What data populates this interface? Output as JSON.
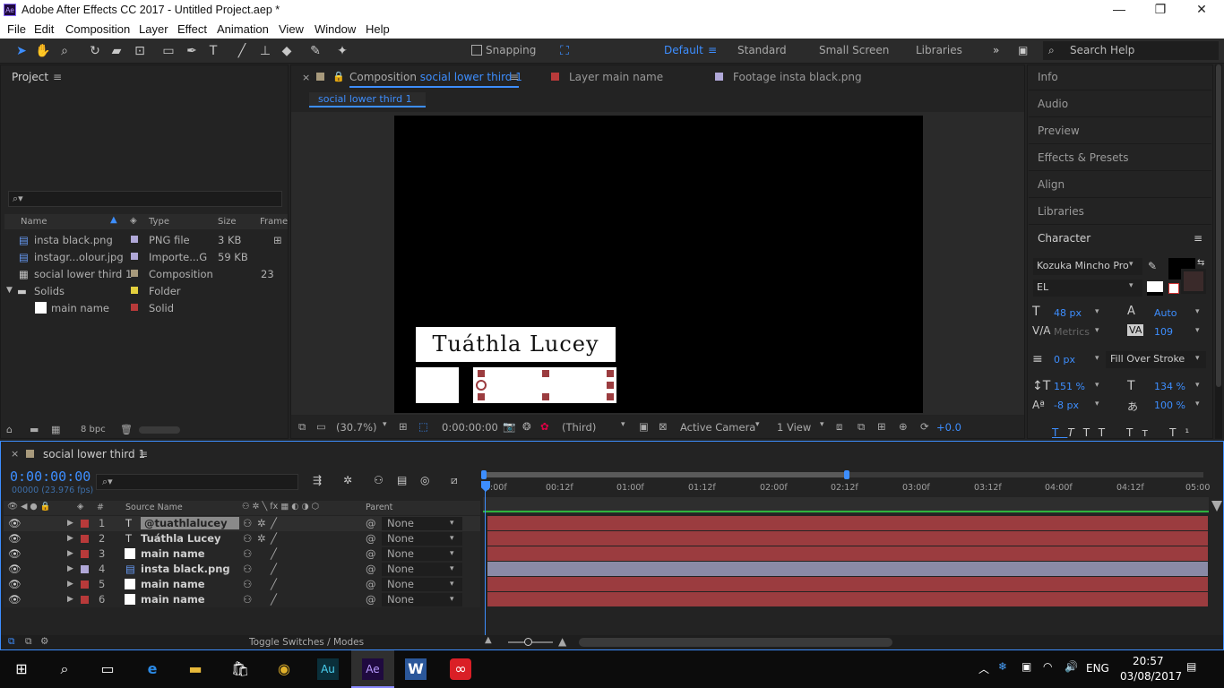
{
  "window": {
    "title": "Adobe After Effects CC 2017 - Untitled Project.aep *",
    "app_icon": "Ae"
  },
  "menu": [
    "File",
    "Edit",
    "Composition",
    "Layer",
    "Effect",
    "Animation",
    "View",
    "Window",
    "Help"
  ],
  "toolbar": {
    "snapping": "Snapping",
    "workspaces": [
      "Default",
      "Standard",
      "Small Screen",
      "Libraries"
    ],
    "search": "Search Help"
  },
  "project": {
    "title": "Project",
    "headers": [
      "Name",
      "Type",
      "Size",
      "Frame"
    ],
    "items": [
      {
        "name": "insta black.png",
        "type": "PNG file",
        "size": "3 KB",
        "frame": "",
        "color": "#b0a8d8"
      },
      {
        "name": "instagr...olour.jpg",
        "type": "Importe...G",
        "size": "59 KB",
        "frame": "",
        "color": "#b0a8d8"
      },
      {
        "name": "social lower third 1",
        "type": "Composition",
        "size": "",
        "frame": "23",
        "color": "#a89a7c"
      },
      {
        "name": "Solids",
        "type": "Folder",
        "size": "",
        "frame": "",
        "color": "#e3cf3d"
      },
      {
        "name": "main name",
        "type": "Solid",
        "size": "",
        "frame": "",
        "color": "#b83a3a"
      }
    ],
    "bpc": "8 bpc"
  },
  "viewer": {
    "tabs": [
      {
        "prefix": "Composition",
        "name": "social lower third 1"
      },
      {
        "prefix": "Layer",
        "name": "main name"
      },
      {
        "prefix": "Footage",
        "name": "insta black.png"
      }
    ],
    "subtab": "social lower third 1",
    "comp_text": "Tuáthla Lucey",
    "zoom": "(30.7%)",
    "timecode": "0:00:00:00",
    "resolution": "(Third)",
    "camera": "Active Camera",
    "views": "1 View",
    "exposure": "+0.0"
  },
  "right_panel": {
    "items": [
      "Info",
      "Audio",
      "Preview",
      "Effects & Presets",
      "Align",
      "Libraries"
    ],
    "character": {
      "title": "Character",
      "font": "Kozuka Mincho Pro",
      "style": "EL",
      "size": "48 px",
      "leading": "Auto",
      "kerning": "Metrics",
      "tracking": "109",
      "stroke": "0 px",
      "stroke_mode": "Fill Over Stroke",
      "v_scale": "151 %",
      "h_scale": "134 %",
      "baseline": "-8 px",
      "tsume": "100 %"
    }
  },
  "timeline": {
    "tab": "social lower third 1",
    "timecode": "0:00:00:00",
    "fps": "00000 (23.976 fps)",
    "headers": {
      "num": "#",
      "source": "Source Name",
      "parent": "Parent"
    },
    "ruler": [
      "0:00f",
      "00:12f",
      "01:00f",
      "01:12f",
      "02:00f",
      "02:12f",
      "03:00f",
      "03:12f",
      "04:00f",
      "04:12f",
      "05:00"
    ],
    "layers": [
      {
        "num": "1",
        "name": "@tuathlalucey",
        "type": "T",
        "color": "#b83a3a",
        "parent": "None",
        "bar": "#9b3c3f"
      },
      {
        "num": "2",
        "name": "Tuáthla Lucey",
        "type": "T",
        "color": "#b83a3a",
        "parent": "None",
        "bar": "#9b3c3f"
      },
      {
        "num": "3",
        "name": "main name",
        "type": "solid",
        "color": "#b83a3a",
        "parent": "None",
        "bar": "#9b3c3f"
      },
      {
        "num": "4",
        "name": "insta black.png",
        "type": "img",
        "color": "#b0a8d8",
        "parent": "None",
        "bar": "#8a8aa6"
      },
      {
        "num": "5",
        "name": "main name",
        "type": "solid",
        "color": "#b83a3a",
        "parent": "None",
        "bar": "#9b3c3f"
      },
      {
        "num": "6",
        "name": "main name",
        "type": "solid",
        "color": "#b83a3a",
        "parent": "None",
        "bar": "#9b3c3f"
      }
    ],
    "toggle": "Toggle Switches / Modes"
  },
  "taskbar": {
    "lang": "ENG",
    "time": "20:57",
    "date": "03/08/2017"
  }
}
